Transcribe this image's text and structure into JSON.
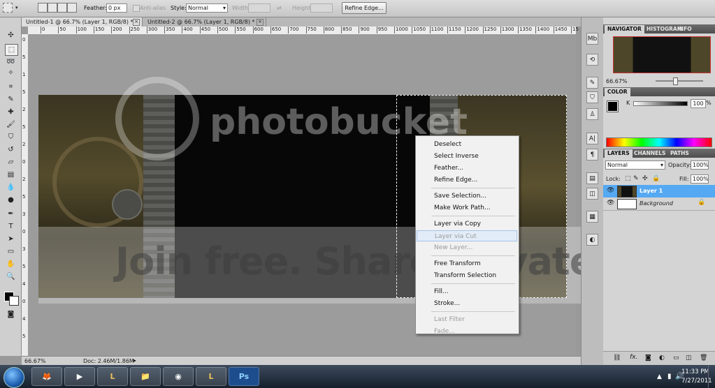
{
  "options_bar": {
    "feather_label": "Feather:",
    "feather_value": "0 px",
    "anti_alias_label": "Anti-alias",
    "style_label": "Style:",
    "style_value": "Normal",
    "width_label": "Width:",
    "height_label": "Height:",
    "refine_edge_button": "Refine Edge..."
  },
  "document_tabs": [
    {
      "label": "Untitled-1 @ 66.7% (Layer 1, RGB/8) *",
      "active": true
    },
    {
      "label": "Untitled-2 @ 66.7% (Layer 1, RGB/8) *",
      "active": false
    }
  ],
  "ruler": {
    "top_marks": [
      "0",
      "50",
      "100",
      "150",
      "200",
      "250",
      "300",
      "350",
      "400",
      "450",
      "500",
      "550",
      "600",
      "650",
      "700",
      "750",
      "800",
      "850",
      "900",
      "950",
      "1000",
      "1050",
      "1100",
      "1150",
      "1200",
      "1250",
      "1300",
      "1350",
      "1400",
      "1450",
      "15"
    ],
    "left_marks": [
      "0",
      "5",
      "1",
      "5",
      "2",
      "5",
      "2",
      "0",
      "2",
      "5",
      "3",
      "0",
      "3",
      "5",
      "4",
      "0",
      "4",
      "5"
    ]
  },
  "watermark": {
    "line1": "photobucket",
    "line2": "Join free. Share privately."
  },
  "context_menu": {
    "groups": [
      [
        {
          "label": "Deselect",
          "enabled": true
        },
        {
          "label": "Select Inverse",
          "enabled": true
        },
        {
          "label": "Feather...",
          "enabled": true
        },
        {
          "label": "Refine Edge...",
          "enabled": true
        }
      ],
      [
        {
          "label": "Save Selection...",
          "enabled": true
        },
        {
          "label": "Make Work Path...",
          "enabled": true
        }
      ],
      [
        {
          "label": "Layer via Copy",
          "enabled": true
        },
        {
          "label": "Layer via Cut",
          "enabled": false,
          "hover": true
        },
        {
          "label": "New Layer...",
          "enabled": false
        }
      ],
      [
        {
          "label": "Free Transform",
          "enabled": true
        },
        {
          "label": "Transform Selection",
          "enabled": true
        }
      ],
      [
        {
          "label": "Fill...",
          "enabled": true
        },
        {
          "label": "Stroke...",
          "enabled": true
        }
      ],
      [
        {
          "label": "Last Filter",
          "enabled": false
        },
        {
          "label": "Fade...",
          "enabled": false
        }
      ]
    ]
  },
  "status_bar": {
    "zoom": "66.67%",
    "doc_size": "Doc: 2.46M/1.86M"
  },
  "navigator_panel": {
    "tabs": [
      "NAVIGATOR",
      "HISTOGRAM",
      "INFO"
    ],
    "zoom": "66.67%"
  },
  "color_panel": {
    "tab": "COLOR",
    "channel_label": "K",
    "value": "100",
    "unit": "%"
  },
  "layers_panel": {
    "tabs": [
      "LAYERS",
      "CHANNELS",
      "PATHS"
    ],
    "blend_mode": "Normal",
    "opacity_label": "Opacity:",
    "opacity_value": "100%",
    "lock_label": "Lock:",
    "fill_label": "Fill:",
    "fill_value": "100%",
    "layers": [
      {
        "name": "Layer 1",
        "selected": true
      },
      {
        "name": "Background",
        "selected": false
      }
    ]
  },
  "taskbar": {
    "time": "11:33 PM",
    "date": "7/27/2011",
    "apps": [
      "firefox",
      "media-player",
      "league-of-legends",
      "file-explorer",
      "steam",
      "league-of-legends",
      "photoshop"
    ],
    "photoshop_label": "Ps",
    "lol_label": "L"
  },
  "colors": {
    "selection_highlight": "#3d8fe0",
    "photoshop_blue": "#1d4d8c",
    "layer_selected": "#55a9f2"
  }
}
